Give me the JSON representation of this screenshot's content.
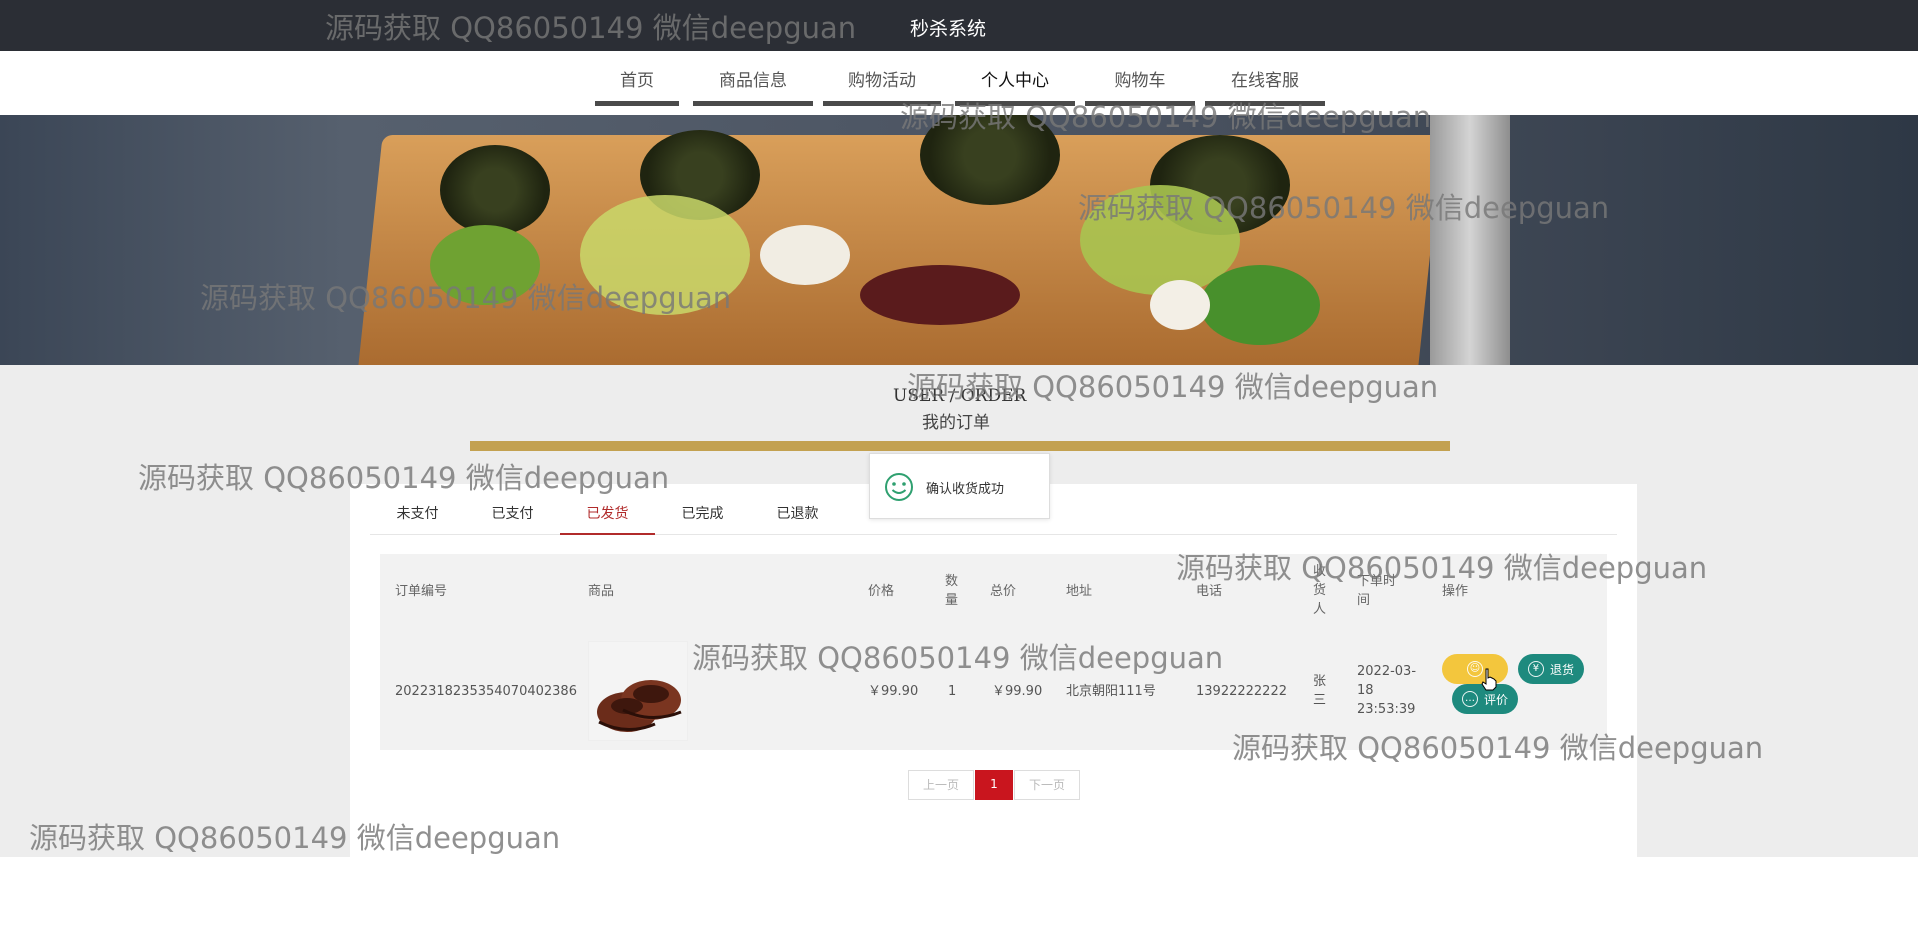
{
  "app": {
    "title": "秒杀系统"
  },
  "nav": {
    "items": [
      {
        "label": "首页"
      },
      {
        "label": "商品信息"
      },
      {
        "label": "购物活动"
      },
      {
        "label": "个人中心"
      },
      {
        "label": "购物车"
      },
      {
        "label": "在线客服"
      }
    ],
    "active": "个人中心"
  },
  "section": {
    "title_en": "USER / ORDER",
    "title_cn": "我的订单"
  },
  "toast": {
    "message": "确认收货成功"
  },
  "order_tabs": {
    "items": [
      {
        "label": "未支付"
      },
      {
        "label": "已支付"
      },
      {
        "label": "已发货"
      },
      {
        "label": "已完成"
      },
      {
        "label": "已退款"
      }
    ],
    "active": "已发货"
  },
  "table": {
    "headers": {
      "order_no": "订单编号",
      "product": "商品",
      "price": "价格",
      "quantity": "数量",
      "total": "总价",
      "address": "地址",
      "phone": "电话",
      "receiver": "收货人",
      "order_time": "下单时间",
      "actions": "操作"
    },
    "rows": [
      {
        "order_no": "2022318235354070402386",
        "product_image": "brown-leather-shoe",
        "price": "￥99.90",
        "quantity": "1",
        "total": "￥99.90",
        "address": "北京朝阳111号",
        "phone": "13922222222",
        "receiver": "张三",
        "order_time": "2022-03-18 23:53:39"
      }
    ],
    "actions": {
      "refund": "退货",
      "review": "评价"
    }
  },
  "pagination": {
    "prev": "上一页",
    "current": "1",
    "next": "下一页"
  },
  "watermark": {
    "text": "源码获取 QQ86050149 微信deepguan"
  },
  "colors": {
    "accent_gold": "#c3a150",
    "active_red": "#c9151e",
    "teal": "#1e8a7e",
    "yellow": "#f3c63d",
    "topbar": "#2b2e35"
  }
}
